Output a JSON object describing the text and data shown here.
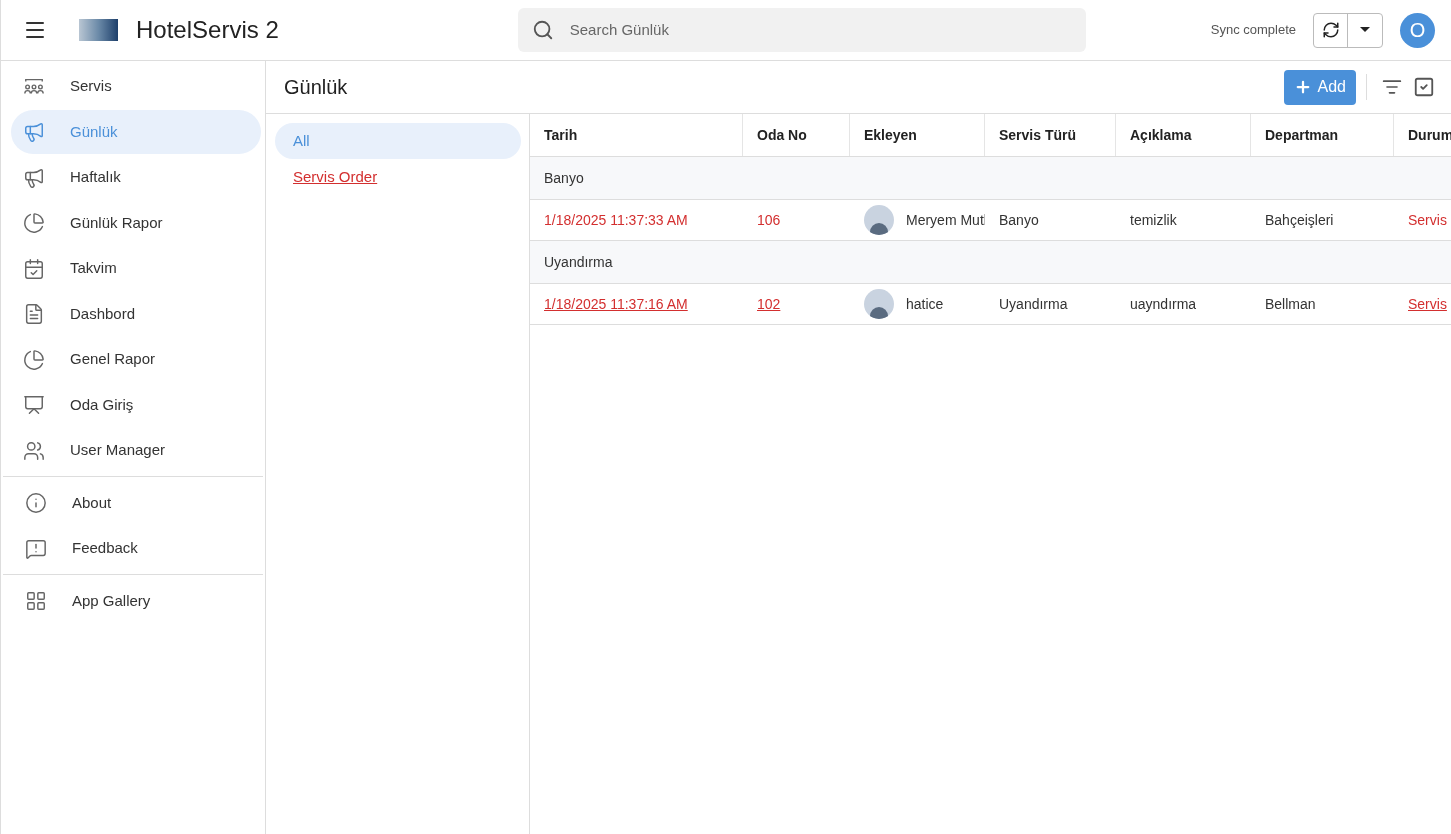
{
  "app": {
    "title": "HotelServis 2",
    "search": {
      "placeholder": "Search Günlük"
    },
    "sync_status": "Sync complete",
    "avatar_initial": "O"
  },
  "sidebar": {
    "groups": [
      {
        "items": [
          {
            "label": "Servis",
            "selected": false
          },
          {
            "label": "Günlük",
            "selected": true
          },
          {
            "label": "Haftalık",
            "selected": false
          },
          {
            "label": "Günlük Rapor",
            "selected": false
          },
          {
            "label": "Takvim",
            "selected": false
          },
          {
            "label": "Dashbord",
            "selected": false
          },
          {
            "label": "Genel Rapor",
            "selected": false
          },
          {
            "label": "Oda Giriş",
            "selected": false
          },
          {
            "label": "User Manager",
            "selected": false
          }
        ]
      },
      {
        "items": [
          {
            "label": "About",
            "selected": false
          },
          {
            "label": "Feedback",
            "selected": false
          }
        ]
      },
      {
        "items": [
          {
            "label": "App Gallery",
            "selected": false
          }
        ]
      }
    ]
  },
  "view": {
    "title": "Günlük",
    "add_button": "Add",
    "views": [
      {
        "label": "All",
        "selected": true
      },
      {
        "label": "Servis Order",
        "selected": false
      }
    ],
    "table": {
      "columns": [
        "Tarih",
        "Oda No",
        "Ekleyen",
        "Servis Türü",
        "Açıklama",
        "Departman",
        "Durum"
      ],
      "groups": [
        {
          "label": "Banyo",
          "rows": [
            {
              "selected": false,
              "tarih": "1/18/2025 11:37:33 AM",
              "oda_no": "106",
              "ekleyen": "Meryem Mutl",
              "servis_turu": "Banyo",
              "aciklama": "temizlik",
              "departman": "Bahçeişleri",
              "durum": "Servis"
            }
          ]
        },
        {
          "label": "Uyandırma",
          "rows": [
            {
              "selected": true,
              "tarih": "1/18/2025 11:37:16 AM",
              "oda_no": "102",
              "ekleyen": "hatice",
              "servis_turu": "Uyandırma",
              "aciklama": "uayndırma",
              "departman": "Bellman",
              "durum": "Servis"
            }
          ]
        }
      ]
    }
  }
}
